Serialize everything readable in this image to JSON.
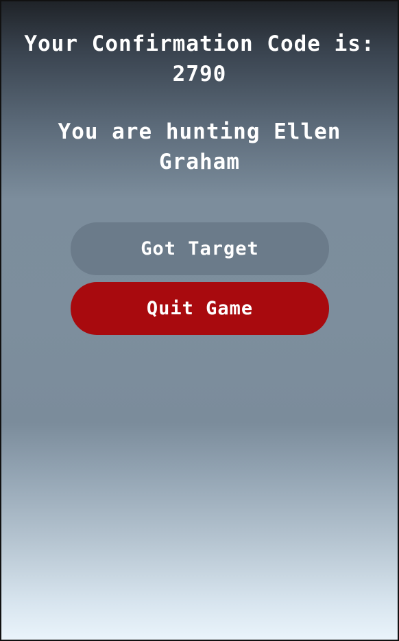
{
  "confirmation": {
    "label": "Your Confirmation Code is:",
    "code": "2790"
  },
  "hunting": {
    "line1": "You are hunting Ellen",
    "line2": "Graham"
  },
  "buttons": {
    "got_target": "Got Target",
    "quit_game": "Quit Game"
  },
  "colors": {
    "quit_button": "#a80a0e",
    "target_button": "#6b7b8a",
    "text": "#ffffff"
  }
}
